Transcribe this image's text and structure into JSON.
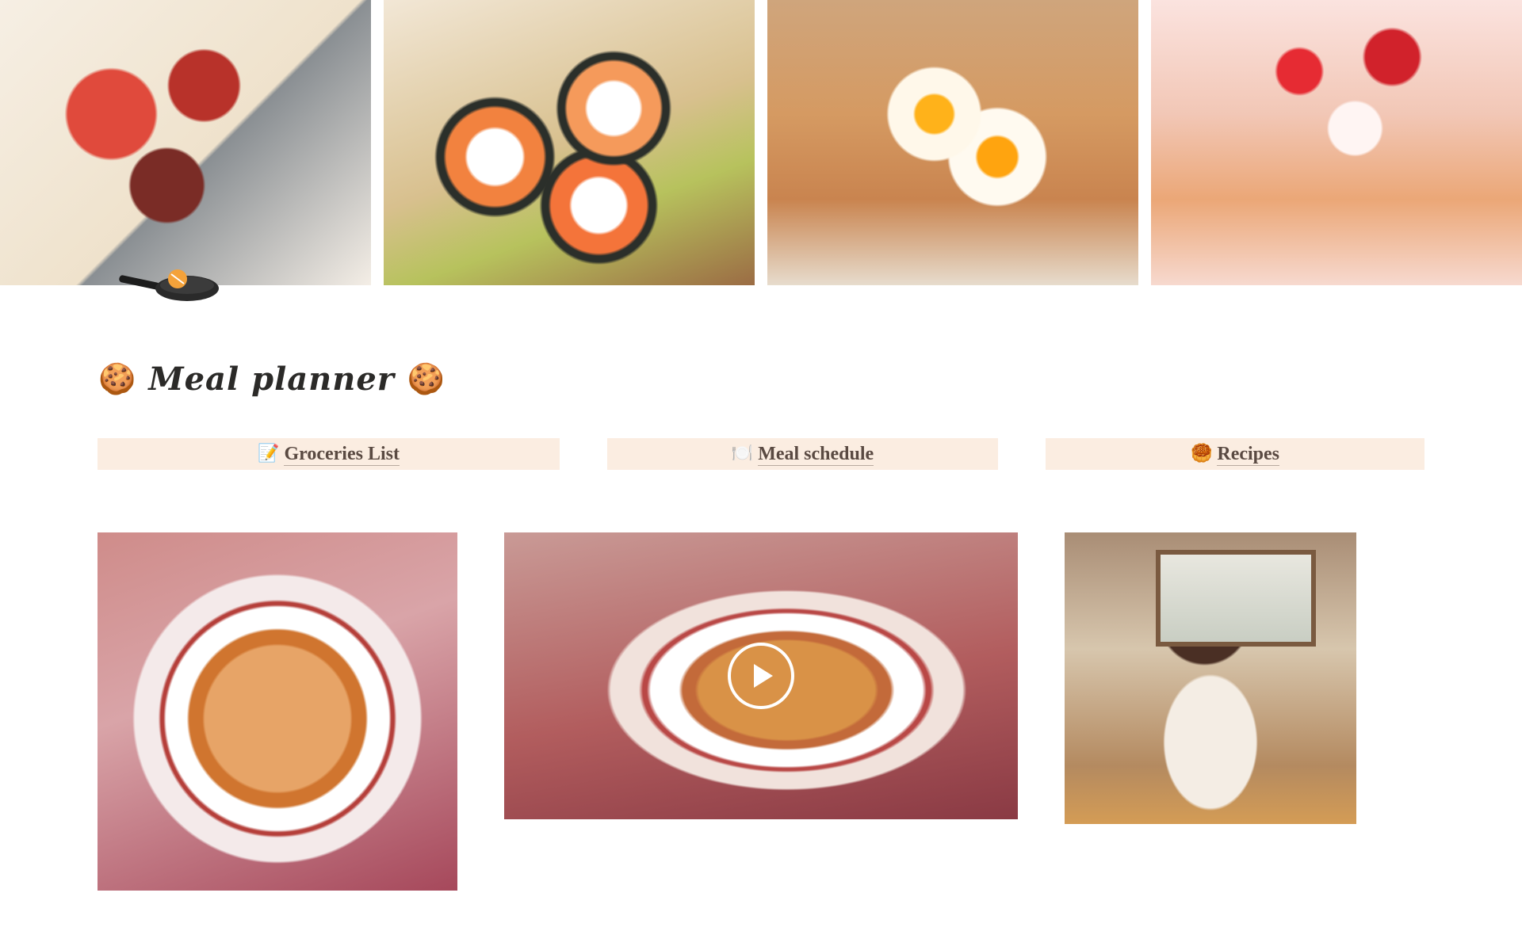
{
  "banner": {
    "panels": [
      {
        "name": "banner-skewers"
      },
      {
        "name": "banner-sushi"
      },
      {
        "name": "banner-eggs-toast"
      },
      {
        "name": "banner-strawberry-pancakes"
      }
    ],
    "page_icon": "frying-pan-icon"
  },
  "page": {
    "title_emoji_left": "🍪",
    "title": "Meal planner",
    "title_emoji_right": "🍪"
  },
  "tabs": [
    {
      "icon": "📝",
      "label": "Groceries List"
    },
    {
      "icon": "🍽️",
      "label": "Meal schedule"
    },
    {
      "icon": "🥮",
      "label": "Recipes"
    }
  ],
  "media": {
    "image_ramen": "ramen-bowl-image",
    "video": "ramen-video",
    "image_girl": "girl-eating-toast-image"
  },
  "colors": {
    "tab_background": "#fbede1",
    "link_text": "#5a4a42"
  }
}
